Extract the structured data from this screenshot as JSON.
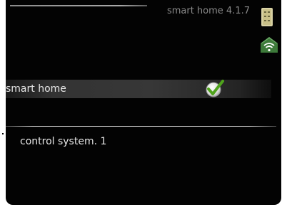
{
  "header": {
    "title": "smart home 4.1.7"
  },
  "icons": {
    "menu": "menu-level-indicator-icon",
    "connection": "wifi-house-icon",
    "selected": "checkmark-icon"
  },
  "menu": {
    "items": [
      {
        "label": "smart home",
        "selected": true
      },
      {
        "label": "control system. 1"
      }
    ]
  },
  "colors": {
    "background": "#030303",
    "text": "#e6e6e6",
    "header_text": "#8a8a8a",
    "check_green": "#4fa31c",
    "wifi_green": "#3d7a3a"
  }
}
